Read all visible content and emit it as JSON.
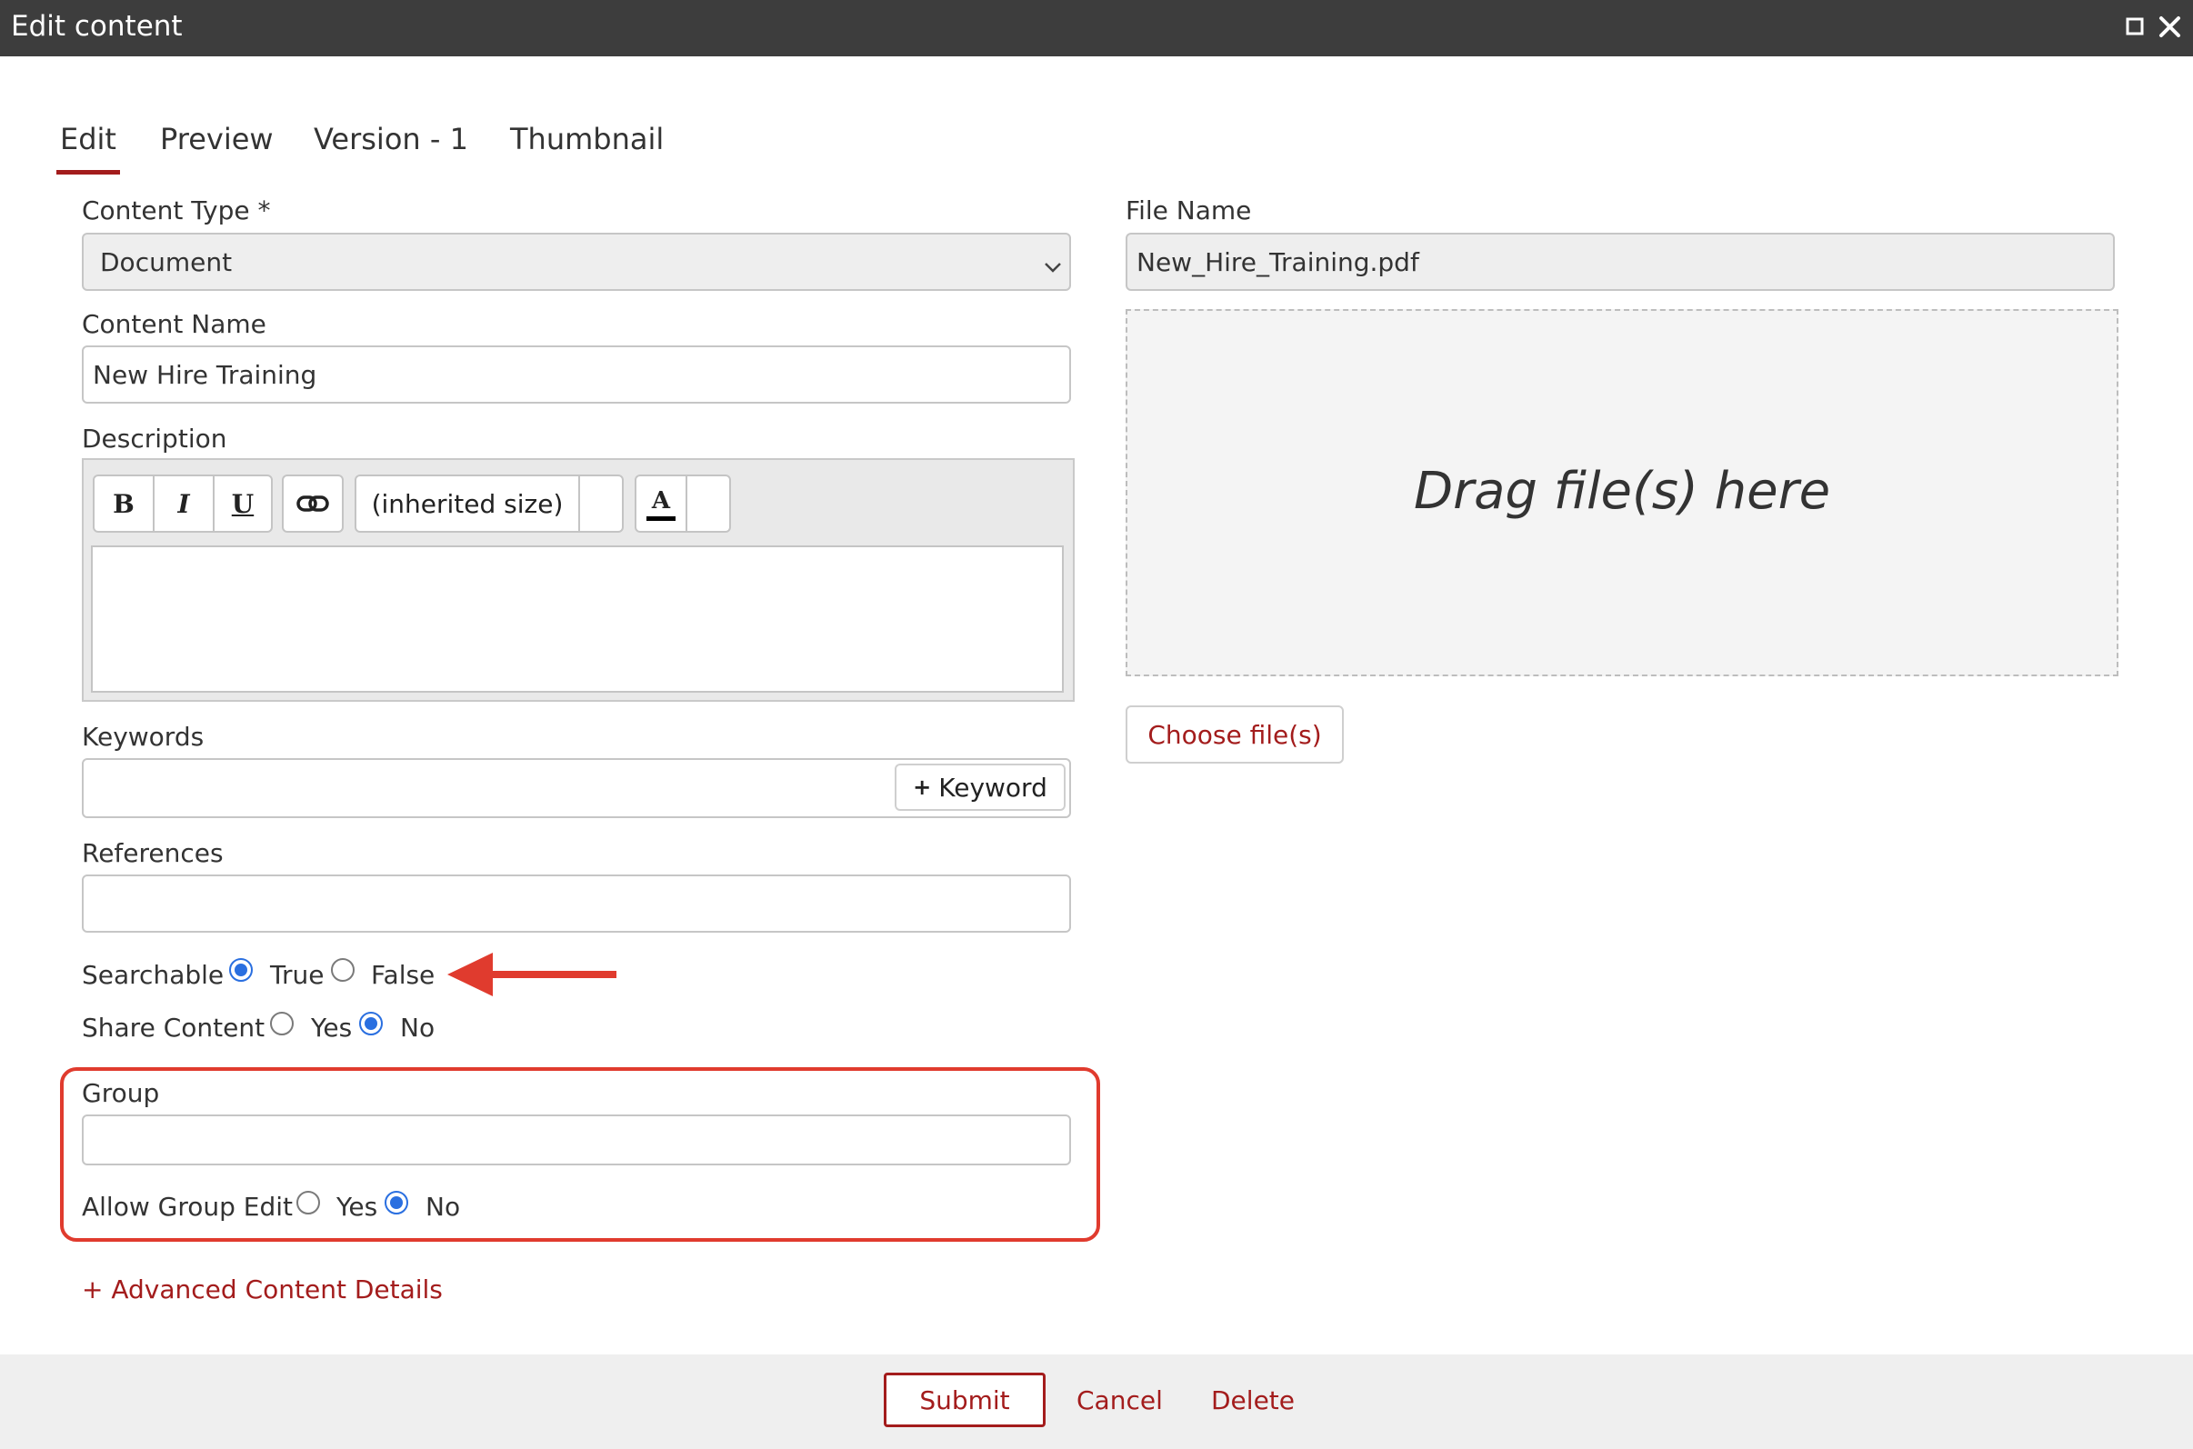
{
  "window": {
    "title": "Edit content",
    "maximize_icon": "maximize-icon",
    "close_icon": "close-icon"
  },
  "tabs": [
    {
      "label": "Edit",
      "active": true
    },
    {
      "label": "Preview",
      "active": false
    },
    {
      "label": "Version - 1",
      "active": false
    },
    {
      "label": "Thumbnail",
      "active": false
    }
  ],
  "form": {
    "content_type": {
      "label": "Content Type *",
      "value": "Document"
    },
    "content_name": {
      "label": "Content Name",
      "value": "New Hire Training"
    },
    "description": {
      "label": "Description",
      "toolbar": {
        "bold": "B",
        "italic": "I",
        "underline": "U",
        "link_icon": "link-icon",
        "font_size": "(inherited size)",
        "font_color": "A"
      },
      "value": ""
    },
    "keywords": {
      "label": "Keywords",
      "add_button": "Keyword",
      "add_icon": "plus-icon"
    },
    "references": {
      "label": "References",
      "value": ""
    },
    "searchable": {
      "label": "Searchable",
      "option_true": "True",
      "option_false": "False",
      "selected": "True"
    },
    "share_content": {
      "label": "Share Content",
      "option_yes": "Yes",
      "option_no": "No",
      "selected": "No"
    },
    "group": {
      "label": "Group",
      "value": ""
    },
    "allow_group_edit": {
      "label": "Allow Group Edit",
      "option_yes": "Yes",
      "option_no": "No",
      "selected": "No"
    },
    "advanced_link": "+ Advanced Content Details"
  },
  "file": {
    "label": "File Name",
    "value": "New_Hire_Training.pdf",
    "dropzone_text": "Drag file(s) here",
    "choose_button": "Choose file(s)"
  },
  "footer": {
    "submit": "Submit",
    "cancel": "Cancel",
    "delete": "Delete"
  },
  "colors": {
    "accent": "#a31c1c",
    "titlebar": "#3d3d3d",
    "annotation": "#e03b2e",
    "radio": "#2a6fe0"
  }
}
